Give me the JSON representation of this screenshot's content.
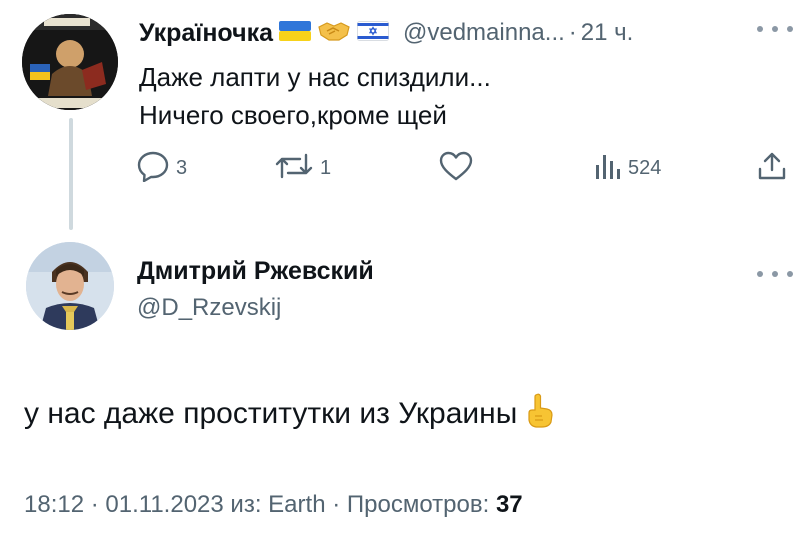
{
  "tweet1": {
    "display_name": "Україночка",
    "handle": "@vedmainna...",
    "separator": "·",
    "time": "21 ч.",
    "text_line1": "Даже лапти у нас спиздили...",
    "text_line2": "Ничего своего,кроме щей",
    "replies": "3",
    "retweets": "1",
    "likes": "",
    "views": "524",
    "emojis": [
      "flag-ukraine",
      "handshake",
      "flag-israel"
    ]
  },
  "tweet2": {
    "display_name": "Дмитрий Ржевский",
    "handle": "@D_Rzevskij",
    "text": "у нас даже проститутки из Украины",
    "emoji": "pointing-up",
    "time": "18:12",
    "date": "01.11.2023",
    "source_prefix": "из:",
    "source": "Earth",
    "views_label": "Просмотров:",
    "views": "37",
    "separator": "·"
  },
  "colors": {
    "text_primary": "#0f1419",
    "text_secondary": "#536471",
    "thread_line": "#cfd9de"
  }
}
